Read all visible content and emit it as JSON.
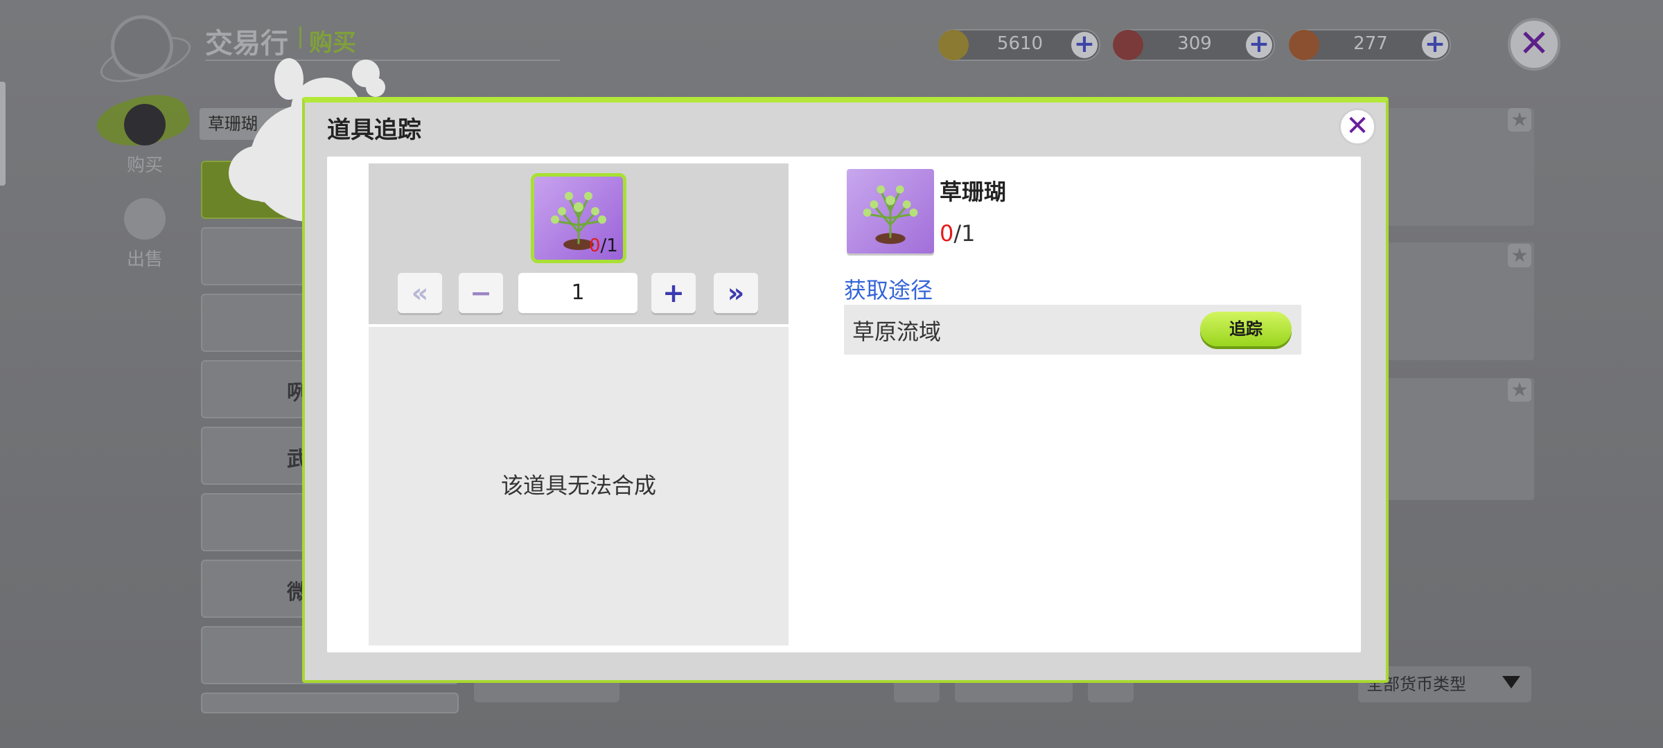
{
  "background": {
    "title": "交易行",
    "subtitle": "购买",
    "currencies": [
      {
        "icon": "gold-coin-icon",
        "value": "5610"
      },
      {
        "icon": "red-ticket-icon",
        "value": "309"
      },
      {
        "icon": "orange-ticket-icon",
        "value": "277"
      }
    ],
    "side_tabs": [
      {
        "icon": "basket-icon",
        "label": "购买"
      },
      {
        "icon": "money-bag-icon",
        "label": "出售"
      }
    ],
    "search_value": "草珊瑚",
    "category_labels": [
      "咧",
      "武",
      "微"
    ],
    "currency_filter": "全部货币类型"
  },
  "modal": {
    "title": "道具追踪",
    "item": {
      "name": "草珊瑚",
      "owned": "0",
      "required": "/1"
    },
    "quantity": "1",
    "no_craft_text": "该道具无法合成",
    "source_title": "获取途径",
    "sources": [
      {
        "name": "草原流域",
        "button": "追踪"
      }
    ]
  },
  "colors": {
    "accent_green": "#a8e034",
    "close_purple": "#6a1c9a",
    "link_blue": "#3465d8",
    "owned_red": "#e41b1b"
  }
}
